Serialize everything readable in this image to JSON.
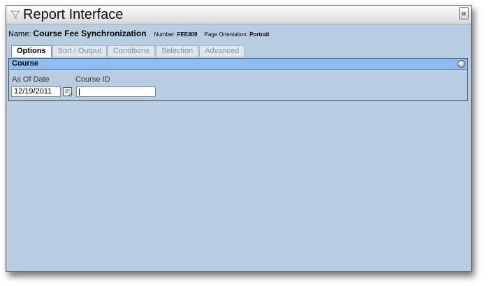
{
  "window": {
    "title": "Report Interface",
    "collapse_label": "«"
  },
  "report": {
    "name_label": "Name:",
    "name_value": "Course Fee Synchronization",
    "number_label": "Number:",
    "number_value": "FEE409",
    "orientation_label": "Page Orientation:",
    "orientation_value": "Portrait"
  },
  "tabs": [
    {
      "label": "Options",
      "active": true
    },
    {
      "label": "Sort / Output",
      "active": false
    },
    {
      "label": "Conditions",
      "active": false
    },
    {
      "label": "Selection",
      "active": false
    },
    {
      "label": "Advanced",
      "active": false
    }
  ],
  "panel": {
    "title": "Course",
    "as_of_date_label": "As Of Date",
    "as_of_date_value": "12/19/2011",
    "course_id_label": "Course ID",
    "course_id_value": ""
  },
  "colors": {
    "window_bg": "#b9cde2",
    "panel_header": "#8fbcf0"
  }
}
